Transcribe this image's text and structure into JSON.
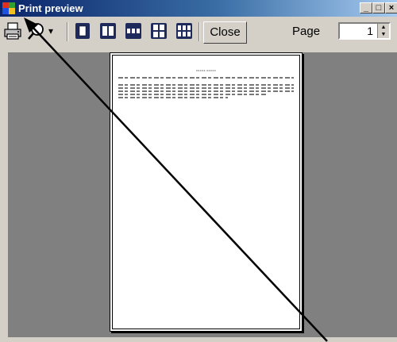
{
  "window": {
    "title": "Print preview",
    "minimize_glyph": "_",
    "maximize_glyph": "□",
    "close_glyph": "×"
  },
  "toolbar": {
    "print_icon": "printer-icon",
    "zoom_icon": "magnifier-icon",
    "zoom_dropdown_glyph": "▾",
    "page_layout_icons": [
      "one-page-icon",
      "two-pages-icon",
      "three-pages-icon",
      "four-pages-icon",
      "six-pages-icon"
    ],
    "close_label": "Close",
    "page_label": "Page",
    "page_value": "1",
    "spin_up": "▲",
    "spin_down": "▼"
  },
  "document": {
    "title": "XXXXX XXXXX"
  },
  "annotation": {
    "arrow_icon": "pointer-arrow",
    "arrow_color": "#000000"
  }
}
